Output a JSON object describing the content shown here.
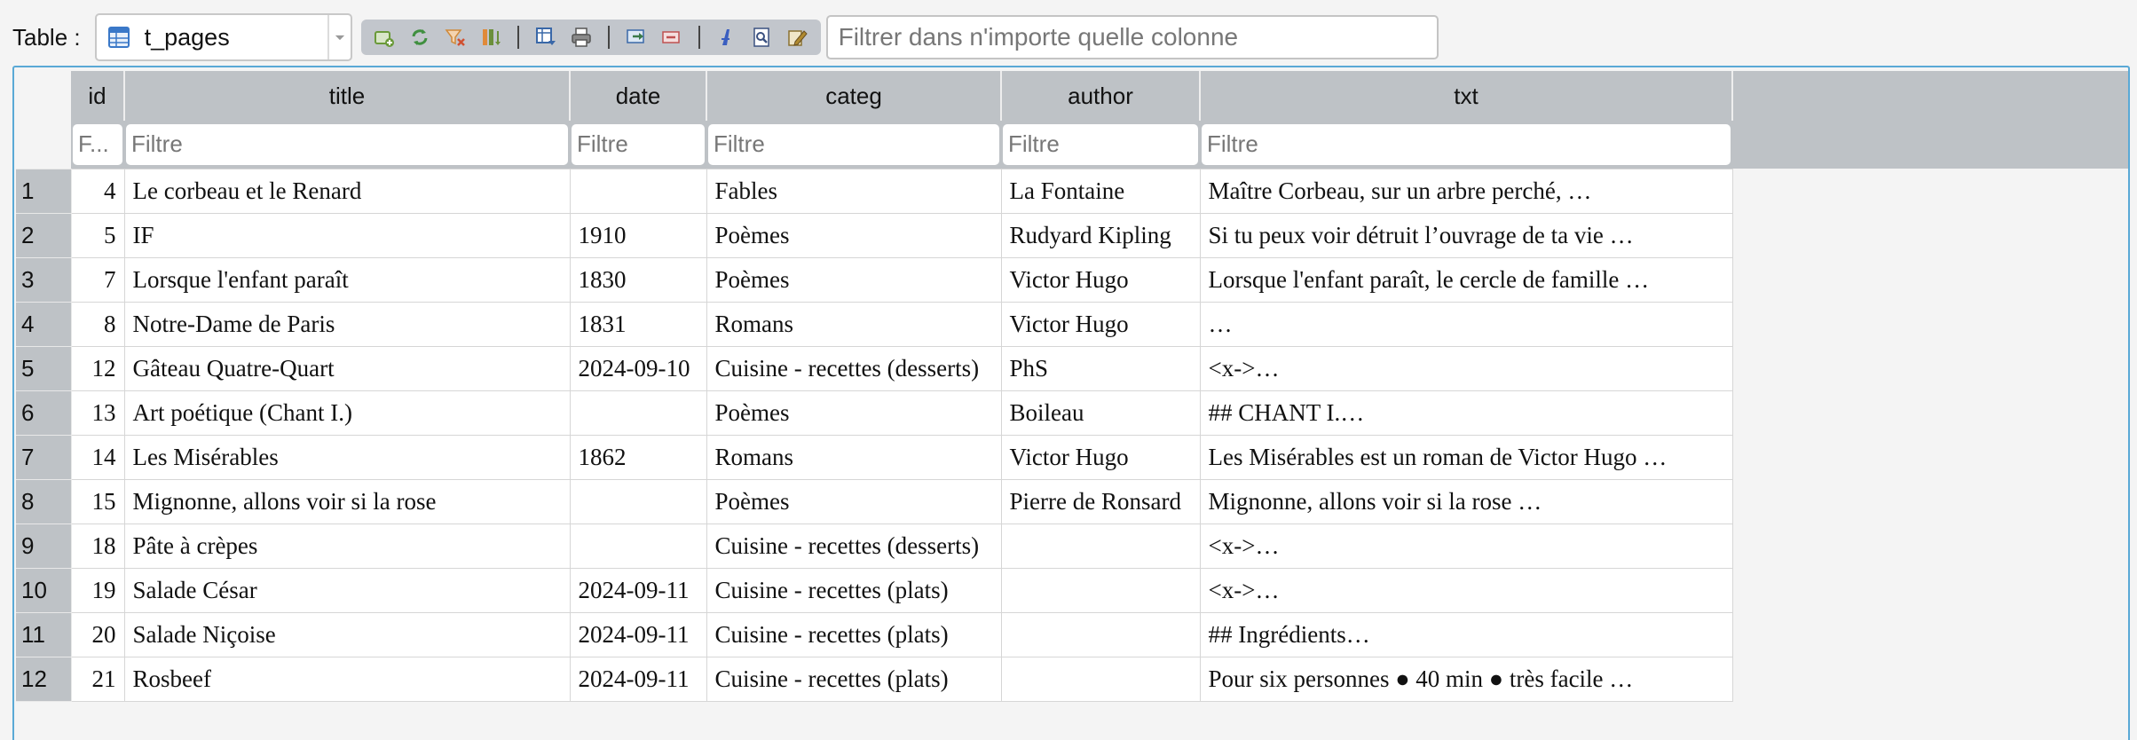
{
  "toolbar": {
    "table_label": "Table :",
    "table_name": "t_pages",
    "global_filter_placeholder": "Filtrer dans n'importe quelle colonne",
    "tools": [
      {
        "name": "add-record-icon",
        "color": "#6a9a3a"
      },
      {
        "name": "refresh-icon",
        "color": "#3f8f3f"
      },
      {
        "name": "clear-filters-icon",
        "color": "#d08a3a"
      },
      {
        "name": "sort-columns-icon",
        "color": "#6b8f3a"
      },
      {
        "name": "export-sheet-icon",
        "color": "#3a68a8"
      },
      {
        "name": "print-icon",
        "color": "#555555"
      },
      {
        "name": "import-icon",
        "color": "#3a7a4a"
      },
      {
        "name": "delete-record-icon",
        "color": "#c05050"
      },
      {
        "name": "font-icon",
        "color": "#3a5ec0"
      },
      {
        "name": "find-replace-icon",
        "color": "#3a5080"
      },
      {
        "name": "edit-icon",
        "color": "#b08a30"
      }
    ]
  },
  "grid": {
    "columns": [
      "id",
      "title",
      "date",
      "categ",
      "author",
      "txt"
    ],
    "filter_placeholders": [
      "F...",
      "Filtre",
      "Filtre",
      "Filtre",
      "Filtre",
      "Filtre"
    ],
    "rows": [
      {
        "n": "1",
        "id": "4",
        "title": "Le corbeau et le Renard",
        "date": "",
        "categ": "Fables",
        "author": "La Fontaine",
        "txt": "Maître Corbeau, sur un arbre perché,   …"
      },
      {
        "n": "2",
        "id": "5",
        "title": "IF",
        "date": "1910",
        "categ": "Poèmes",
        "author": "Rudyard Kipling",
        "txt": "Si tu peux voir détruit l’ouvrage de ta vie  …"
      },
      {
        "n": "3",
        "id": "7",
        "title": "Lorsque l'enfant paraît",
        "date": "1830",
        "categ": "Poèmes",
        "author": "Victor Hugo",
        "txt": "Lorsque l'enfant paraît, le cercle de famille  …"
      },
      {
        "n": "4",
        "id": "8",
        "title": "Notre-Dame de Paris",
        "date": "1831",
        "categ": "Romans",
        "author": "Victor Hugo",
        "txt": "…"
      },
      {
        "n": "5",
        "id": "12",
        "title": "Gâteau Quatre-Quart",
        "date": "2024-09-10",
        "categ": "Cuisine - recettes (desserts)",
        "author": "PhS",
        "txt": "<x->…"
      },
      {
        "n": "6",
        "id": "13",
        "title": "Art poétique (Chant I.)",
        "date": "",
        "categ": "Poèmes",
        "author": "Boileau",
        "txt": "## CHANT I.…"
      },
      {
        "n": "7",
        "id": "14",
        "title": "Les Misérables",
        "date": "1862",
        "categ": "Romans",
        "author": "Victor Hugo",
        "txt": "Les Misérables est un roman de Victor Hugo …"
      },
      {
        "n": "8",
        "id": "15",
        "title": "Mignonne, allons voir si la rose",
        "date": "",
        "categ": "Poèmes",
        "author": "Pierre de Ronsard",
        "txt": "Mignonne, allons voir si la rose  …"
      },
      {
        "n": "9",
        "id": "18",
        "title": "Pâte à crèpes",
        "date": "",
        "categ": "Cuisine - recettes (desserts)",
        "author": "",
        "txt": "<x->…"
      },
      {
        "n": "10",
        "id": "19",
        "title": "Salade César",
        "date": "2024-09-11",
        "categ": "Cuisine - recettes (plats)",
        "author": "",
        "txt": "<x->…"
      },
      {
        "n": "11",
        "id": "20",
        "title": "Salade Niçoise",
        "date": "2024-09-11",
        "categ": "Cuisine - recettes (plats)",
        "author": "",
        "txt": "## Ingrédients…"
      },
      {
        "n": "12",
        "id": "21",
        "title": "Rosbeef",
        "date": "2024-09-11",
        "categ": "Cuisine - recettes (plats)",
        "author": "",
        "txt": "Pour six personnes ● 40 min ● très facile …"
      }
    ]
  }
}
